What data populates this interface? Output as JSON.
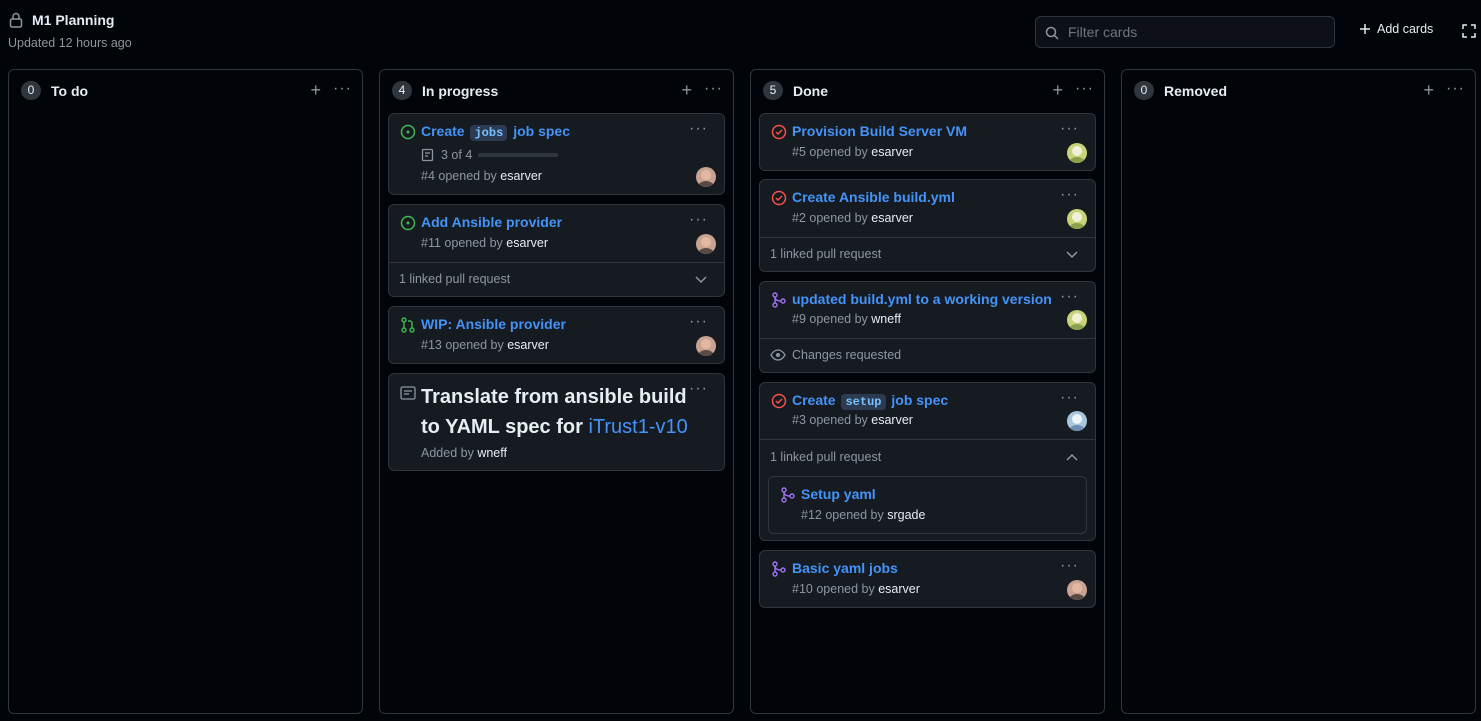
{
  "header": {
    "title": "M1 Planning",
    "updated": "Updated 12 hours ago",
    "filter_placeholder": "Filter cards",
    "add_cards_label": "Add cards"
  },
  "columns": [
    {
      "name": "To do",
      "count": "0"
    },
    {
      "name": "In progress",
      "count": "4"
    },
    {
      "name": "Done",
      "count": "5"
    },
    {
      "name": "Removed",
      "count": "0"
    }
  ],
  "inprogress": {
    "card1": {
      "title_pre": "Create",
      "title_code": "jobs",
      "title_post": "job spec",
      "progress": "3 of 4",
      "progress_fraction": 0.75,
      "number": "#4",
      "opened_by": "opened by",
      "user": "esarver"
    },
    "card2": {
      "title": "Add Ansible provider",
      "number": "#11",
      "opened_by": "opened by",
      "user": "esarver",
      "linked": "1 linked pull request"
    },
    "card3": {
      "title": "WIP: Ansible provider",
      "number": "#13",
      "opened_by": "opened by",
      "user": "esarver"
    },
    "note": {
      "text": "Translate from ansible build to YAML spec for",
      "link": "iTrust1-v10",
      "added_by": "Added by",
      "user": "wneff"
    }
  },
  "done": {
    "card1": {
      "title": "Provision Build Server VM",
      "number": "#5",
      "opened_by": "opened by",
      "user": "esarver"
    },
    "card2": {
      "title": "Create Ansible build.yml",
      "number": "#2",
      "opened_by": "opened by",
      "user": "esarver",
      "linked": "1 linked pull request"
    },
    "card3": {
      "title": "updated build.yml to a working version",
      "number": "#9",
      "opened_by": "opened by",
      "user": "wneff",
      "status": "Changes requested"
    },
    "card4": {
      "title_pre": "Create",
      "title_code": "setup",
      "title_post": "job spec",
      "number": "#3",
      "opened_by": "opened by",
      "user": "esarver",
      "linked": "1 linked pull request",
      "sub": {
        "title": "Setup yaml",
        "number": "#12",
        "opened_by": "opened by",
        "user": "srgade"
      }
    },
    "card5": {
      "title": "Basic yaml jobs",
      "number": "#10",
      "opened_by": "opened by",
      "user": "esarver"
    }
  },
  "colors": {
    "open": "#3fb950",
    "closed": "#f85149",
    "merged": "#a371f7",
    "link": "#4493f8"
  }
}
